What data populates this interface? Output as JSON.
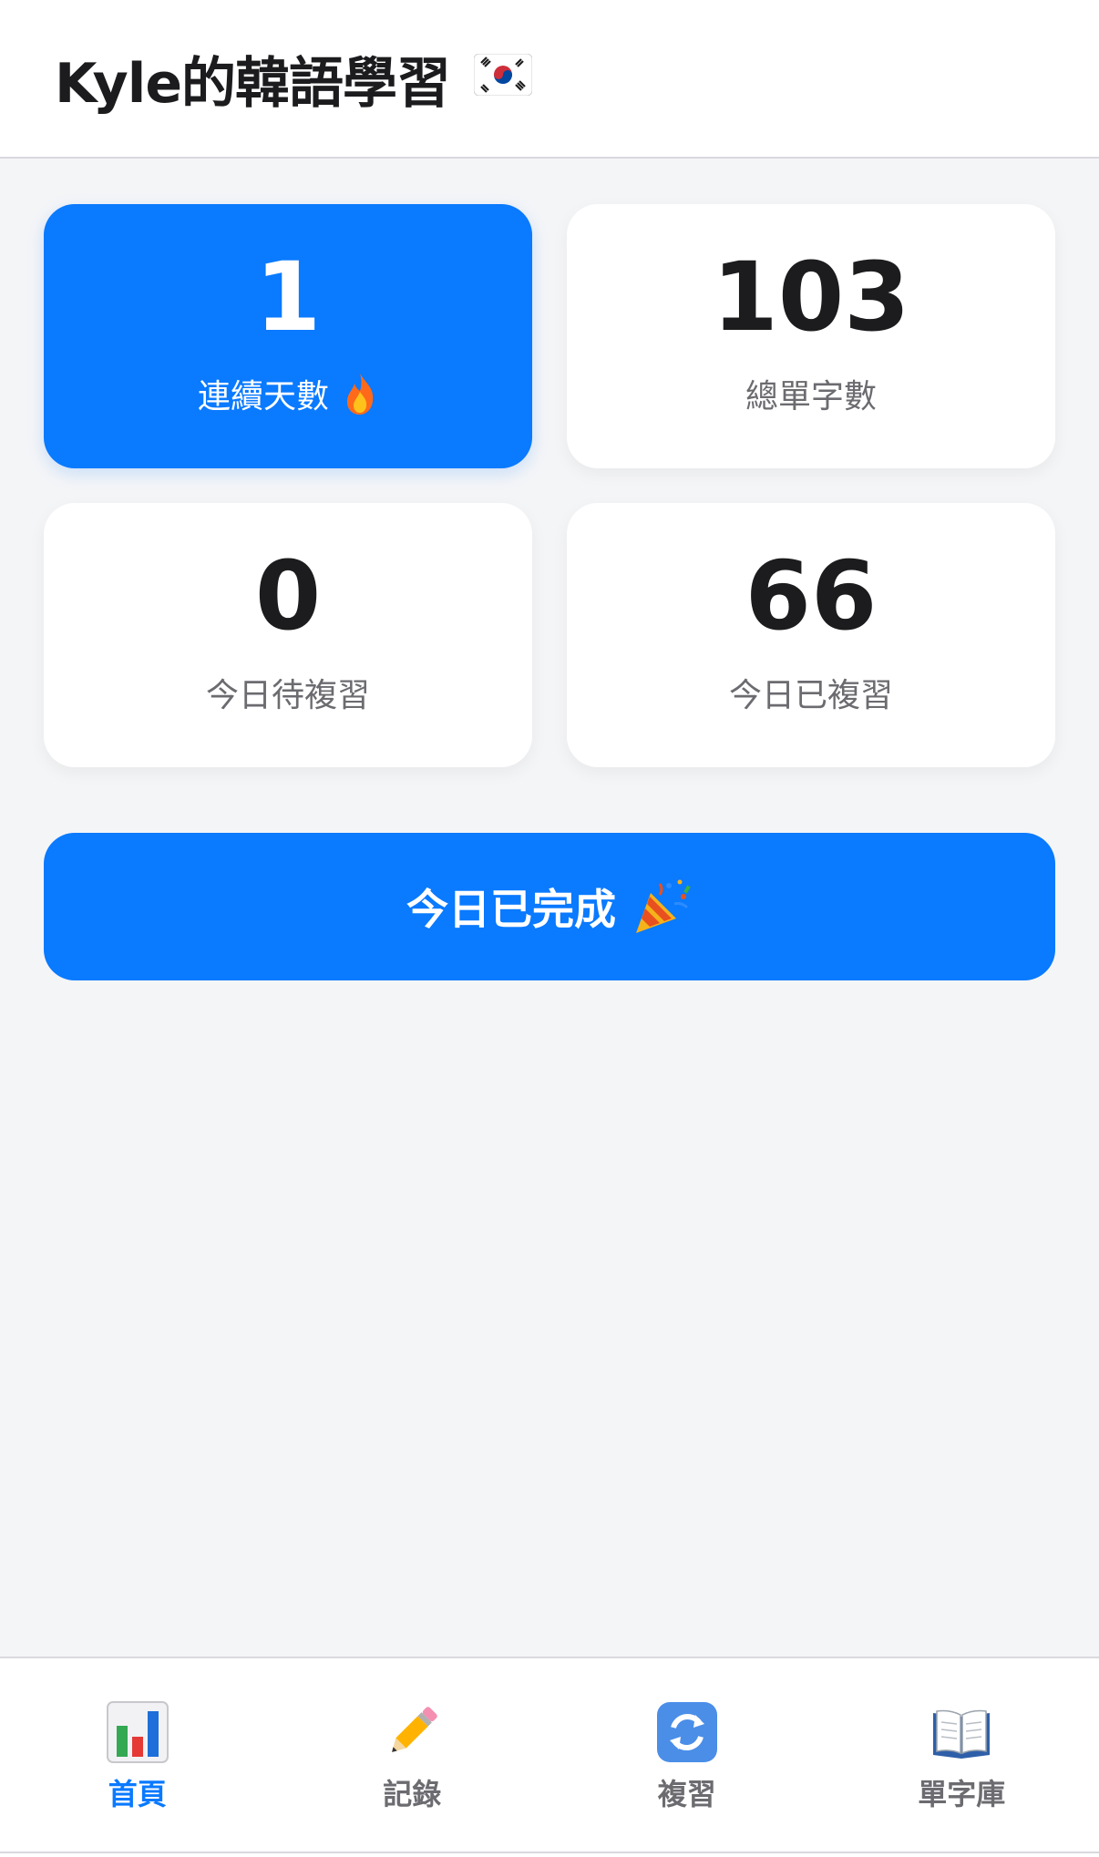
{
  "header": {
    "title": "Kyle的韓語學習",
    "flag_icon": "south-korea-flag-icon"
  },
  "stats": [
    {
      "value": "1",
      "label": "連續天數",
      "icon": "fire-icon"
    },
    {
      "value": "103",
      "label": "總單字數"
    },
    {
      "value": "0",
      "label": "今日待複習"
    },
    {
      "value": "66",
      "label": "今日已複習"
    }
  ],
  "complete_button": {
    "label": "今日已完成",
    "icon": "party-popper-icon"
  },
  "tabs": [
    {
      "label": "首頁",
      "icon": "bar-chart-icon",
      "active": true
    },
    {
      "label": "記錄",
      "icon": "pencil-icon",
      "active": false
    },
    {
      "label": "複習",
      "icon": "refresh-icon",
      "active": false
    },
    {
      "label": "單字庫",
      "icon": "open-book-icon",
      "active": false
    }
  ],
  "colors": {
    "accent": "#0a7aff",
    "background": "#f4f5f7",
    "card": "#ffffff",
    "text_primary": "#1c1c1e",
    "text_secondary": "#6b6b70"
  }
}
